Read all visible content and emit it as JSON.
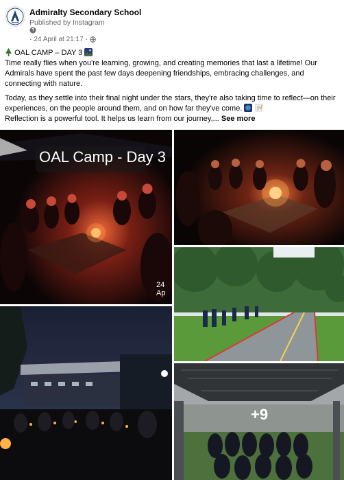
{
  "post": {
    "page_name": "Admiralty Secondary School",
    "published_via": "Published by Instagram",
    "date": "24 April at 21:17",
    "date_prefix": "·",
    "text": {
      "title": "OAL CAMP – DAY 3",
      "para1": "Time really flies when you're learning, growing, and creating memories that last a lifetime! Our Admirals have spent the past few days deepening friendships, embracing challenges, and connecting with nature.",
      "para2": "Today, as they settle into their final night under the stars, they're also taking time to reflect—on their experiences, on the people around them, and on how far they've come.",
      "para3": "Reflection is a powerful tool. It helps us learn from our journey,...",
      "see_more": "See more"
    }
  },
  "photos": {
    "overlay_title": "OAL Camp - Day 3",
    "overlay_date": "24 Ap",
    "more_count": "+9"
  },
  "icons": {
    "avatar": "school-crest-icon",
    "meta": "question-circle-icon",
    "audience": "globe-icon"
  },
  "colors": {
    "text_primary": "#050505",
    "text_secondary": "#65676b",
    "background": "#ffffff"
  }
}
